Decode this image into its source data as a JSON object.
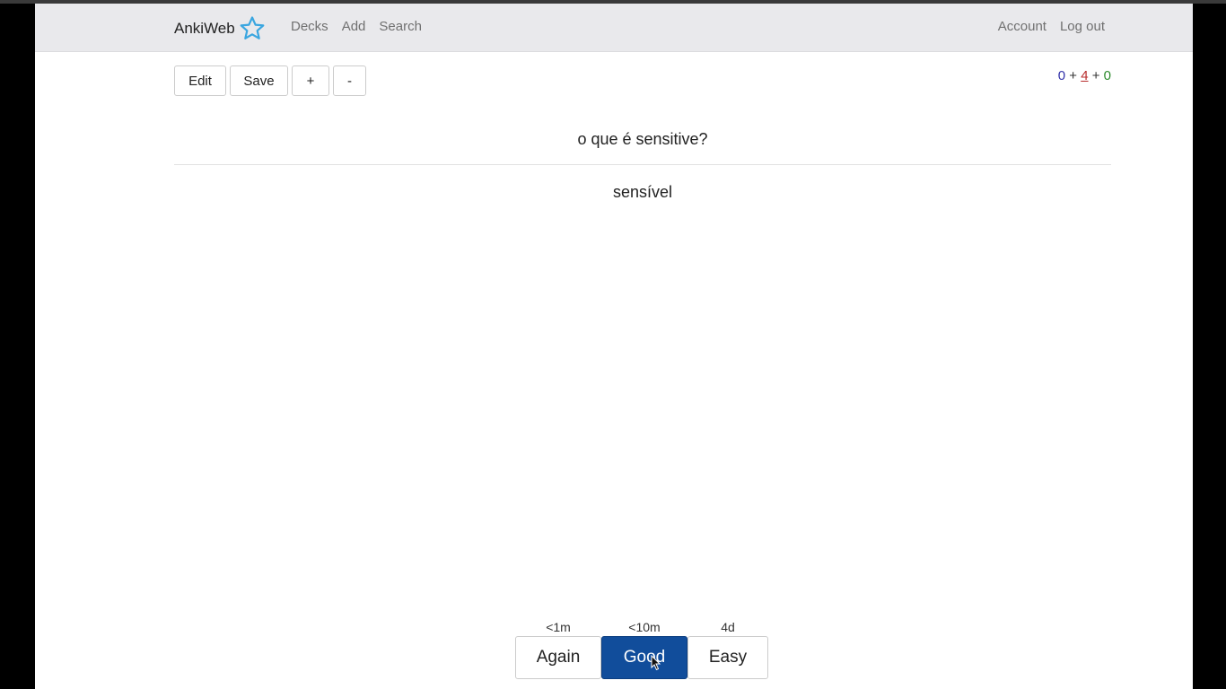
{
  "navbar": {
    "brand": "AnkiWeb",
    "brand_icon": "star-icon",
    "brand_icon_color": "#3aa6e0",
    "links": [
      "Decks",
      "Add",
      "Search"
    ],
    "right_links": [
      "Account",
      "Log out"
    ]
  },
  "toolbar": {
    "edit_label": "Edit",
    "save_label": "Save",
    "plus_label": "+",
    "minus_label": "-"
  },
  "counts": {
    "new": "0",
    "learning": "4",
    "review": "0",
    "sep1": "+",
    "sep2": "+",
    "new_color": "#3333aa",
    "learning_color": "#b72b2b",
    "review_color": "#2c8a2c"
  },
  "card": {
    "question": "o que é sensitive?",
    "answer": "sensível"
  },
  "ease_buttons": [
    {
      "time": "<1m",
      "label": "Again"
    },
    {
      "time": "<10m",
      "label": "Good"
    },
    {
      "time": "4d",
      "label": "Easy"
    }
  ],
  "colors": {
    "good_button": "#114d9b",
    "navbar_bg": "#e9e9ec"
  }
}
